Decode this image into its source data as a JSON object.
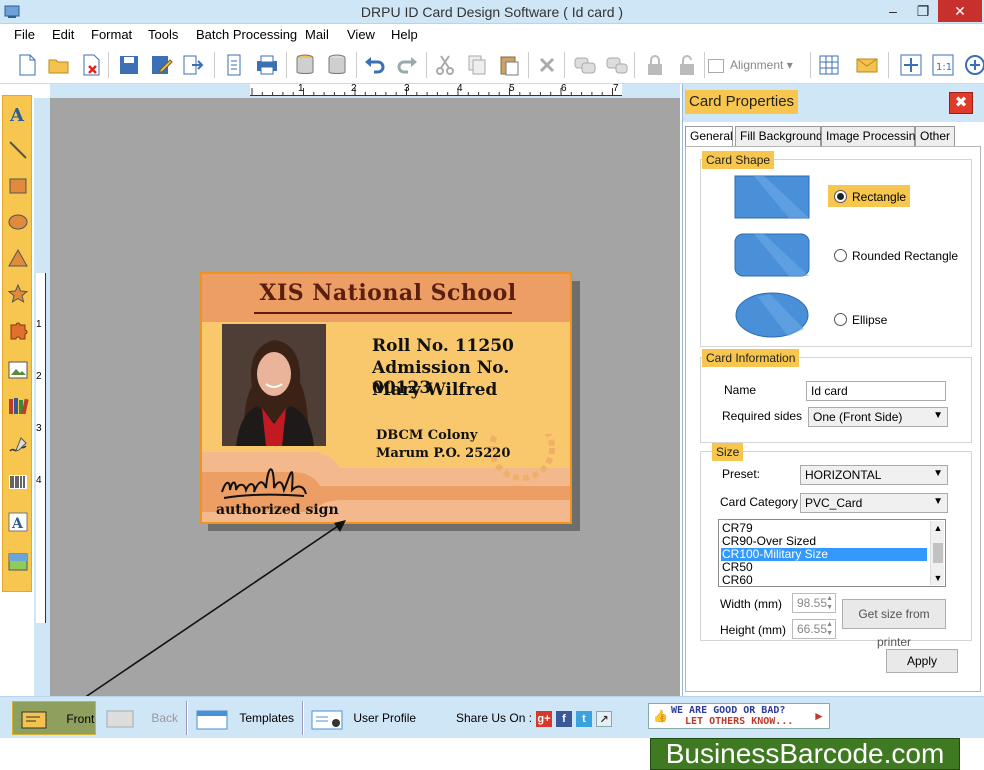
{
  "window": {
    "title": "DRPU ID Card Design Software ( Id card )"
  },
  "menu": [
    "File",
    "Edit",
    "Format",
    "Tools",
    "Batch Processing",
    "Mail",
    "View",
    "Help"
  ],
  "toolbar": {
    "alignment_label": "Alignment"
  },
  "card": {
    "school": "XIS National School",
    "roll": "Roll No. 11250",
    "admission": "Admission No. 00123",
    "name": "Mary Wilfred",
    "address1": "DBCM Colony",
    "address2": "Marum P.O. 25220",
    "sign_label": "authorized sign"
  },
  "panel": {
    "title": "Card Properties",
    "tabs": [
      "General",
      "Fill Background",
      "Image Processing",
      "Other"
    ],
    "card_shape": {
      "title": "Card Shape",
      "options": [
        "Rectangle",
        "Rounded Rectangle",
        "Ellipse"
      ],
      "selected": "Rectangle"
    },
    "card_info": {
      "title": "Card Information",
      "name_label": "Name",
      "name_value": "Id card",
      "sides_label": "Required sides",
      "sides_value": "One (Front Side)"
    },
    "size": {
      "title": "Size",
      "preset_label": "Preset:",
      "preset_value": "HORIZONTAL",
      "category_label": "Card Category",
      "category_value": "PVC_Card",
      "list": [
        "CR79",
        "CR90-Over Sized",
        "CR100-Military Size",
        "CR50",
        "CR60"
      ],
      "selected": "CR100-Military Size",
      "width_label": "Width  (mm)",
      "width_value": "98.55",
      "height_label": "Height (mm)",
      "height_value": "66.55",
      "get_size_button": "Get size from printer"
    },
    "apply_button": "Apply"
  },
  "ruler": {
    "h_ticks": [
      "1",
      "2",
      "3",
      "4",
      "5",
      "6",
      "7"
    ],
    "v_ticks": [
      "1",
      "2",
      "3",
      "4"
    ]
  },
  "bottom": {
    "front": "Front",
    "back": "Back",
    "templates": "Templates",
    "user_profile": "User Profile",
    "share_label": "Share Us On :",
    "banner_line1": "WE ARE GOOD OR BAD?",
    "banner_line2": "LET OTHERS KNOW..."
  },
  "watermark": "BusinessBarcode.com"
}
